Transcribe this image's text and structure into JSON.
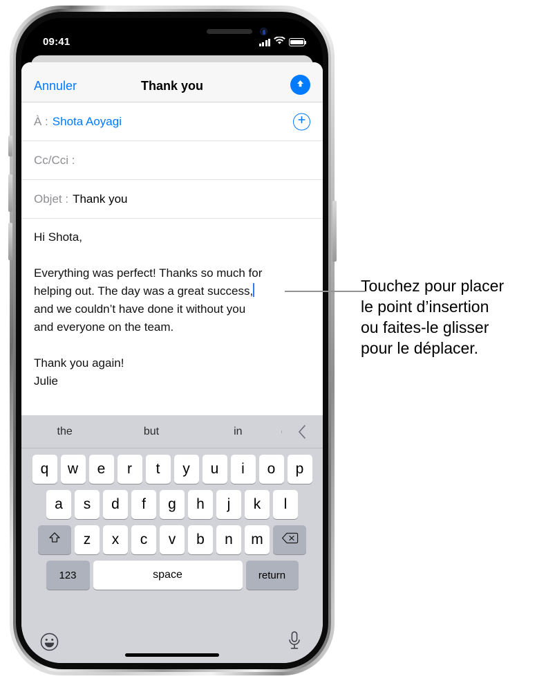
{
  "status_bar": {
    "time": "09:41",
    "signal_icon": "cellular-bars-icon",
    "wifi_icon": "wifi-icon",
    "battery_icon": "battery-icon"
  },
  "navbar": {
    "cancel_label": "Annuler",
    "title": "Thank you",
    "send_icon": "arrow-up-icon"
  },
  "fields": {
    "to": {
      "label": "À :",
      "value": "Shota Aoyagi",
      "add_icon": "plus-circle-icon"
    },
    "cc": {
      "label": "Cc/Cci :",
      "value": ""
    },
    "subject": {
      "label": "Objet :",
      "value": "Thank you"
    }
  },
  "body": {
    "greeting": "Hi Shota,",
    "paragraph_lines": [
      "Everything was perfect! Thanks so much for",
      "helping out. The day was a great success,",
      "and we couldn’t have done it without you",
      "and everyone on the team."
    ],
    "closing": "Thank you again!",
    "signature": "Julie"
  },
  "keyboard": {
    "suggestions": [
      "the",
      "but",
      "in"
    ],
    "suggest_arrow_icon": "chevron-left-icon",
    "row1": [
      "q",
      "w",
      "e",
      "r",
      "t",
      "y",
      "u",
      "i",
      "o",
      "p"
    ],
    "row2": [
      "a",
      "s",
      "d",
      "f",
      "g",
      "h",
      "j",
      "k",
      "l"
    ],
    "row3": [
      "z",
      "x",
      "c",
      "v",
      "b",
      "n",
      "m"
    ],
    "shift_icon": "shift-arrow-up-icon",
    "delete_icon": "backspace-icon",
    "numbers_label": "123",
    "space_label": "space",
    "return_label": "return",
    "emoji_icon": "smiley-face-icon",
    "dictation_icon": "microphone-icon"
  },
  "callout": {
    "lines": [
      "Touchez pour placer",
      "le point d’insertion",
      "ou faites-le glisser",
      "pour le déplacer."
    ]
  },
  "colors": {
    "accent": "#007aff",
    "caret": "#3478f6",
    "keyboard_bg": "#d1d3d9"
  }
}
